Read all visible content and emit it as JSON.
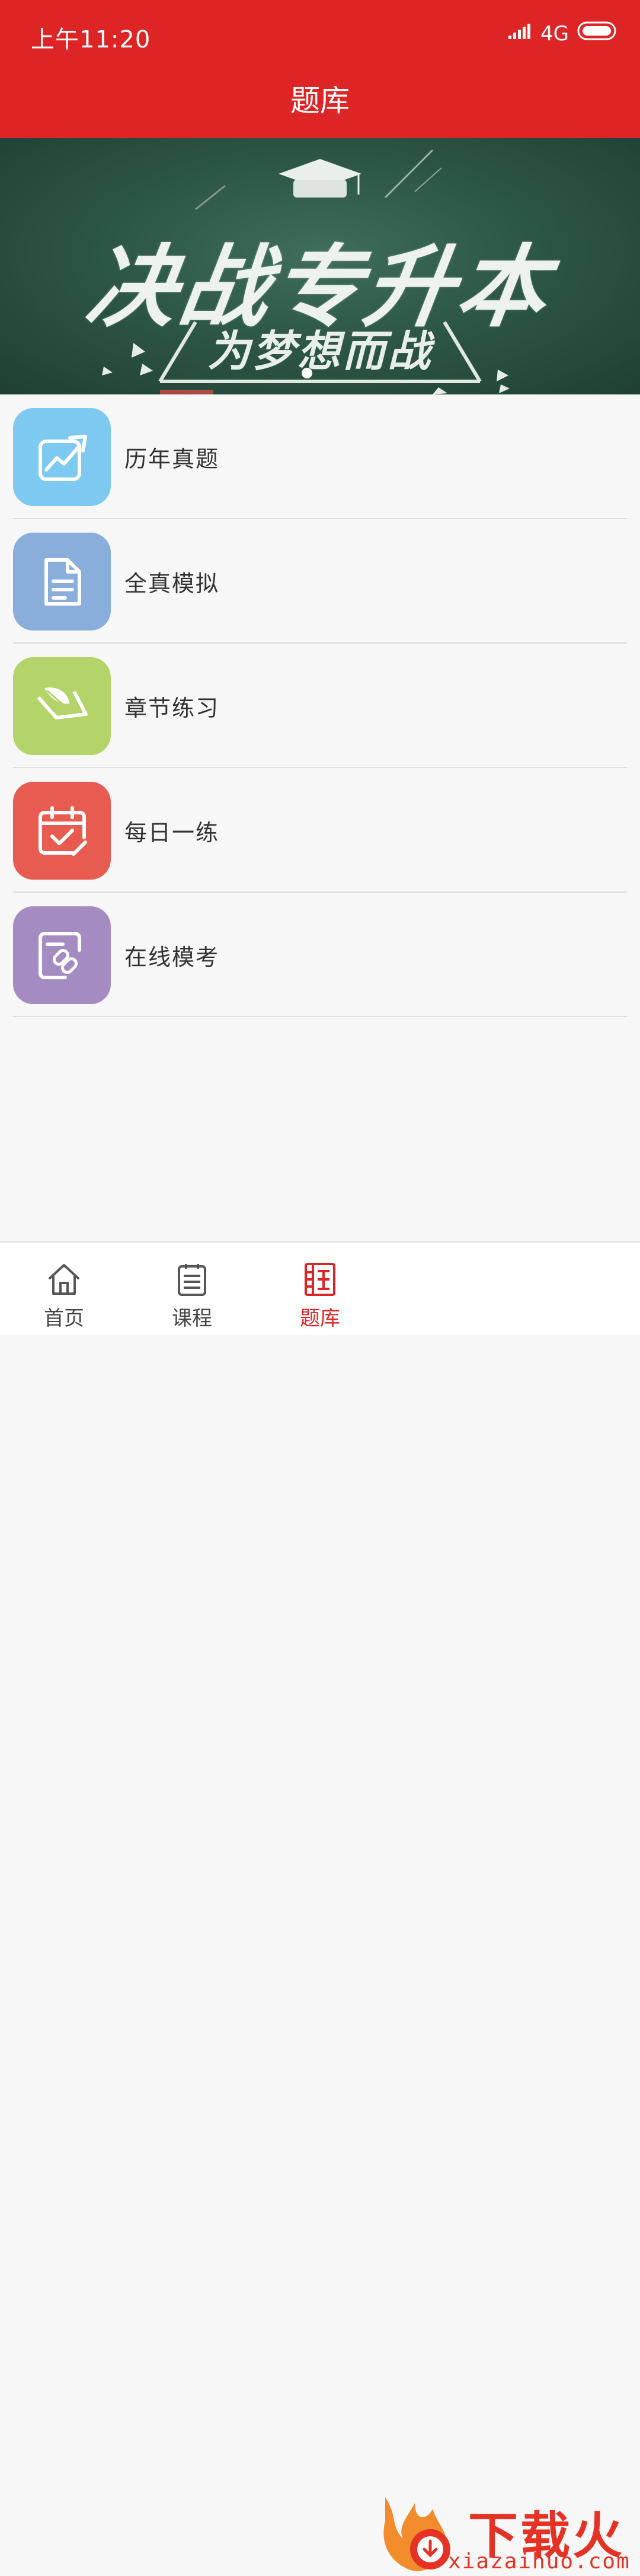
{
  "status_bar": {
    "time": "上午11:20",
    "network": "4G"
  },
  "nav": {
    "title": "题库"
  },
  "banner": {
    "title": "决战专升本",
    "subtitle": "为梦想而战"
  },
  "menu": [
    {
      "label": "历年真题",
      "icon": "trend-chart-icon",
      "color": "#7ec9f0"
    },
    {
      "label": "全真模拟",
      "icon": "document-icon",
      "color": "#89aedc"
    },
    {
      "label": "章节练习",
      "icon": "quill-paper-icon",
      "color": "#b4d46a"
    },
    {
      "label": "每日一练",
      "icon": "calendar-check-icon",
      "color": "#e85b50"
    },
    {
      "label": "在线模考",
      "icon": "link-edit-icon",
      "color": "#a48cc2"
    }
  ],
  "tabs": [
    {
      "label": "首页",
      "icon": "home-icon",
      "active": false
    },
    {
      "label": "课程",
      "icon": "clipboard-list-icon",
      "active": false
    },
    {
      "label": "题库",
      "icon": "question-bank-icon",
      "active": true
    }
  ],
  "watermark": {
    "text": "下载火",
    "url": "xiazaihuo.com"
  },
  "colors": {
    "brand_red": "#dd2526",
    "background": "#f7f7f7"
  }
}
